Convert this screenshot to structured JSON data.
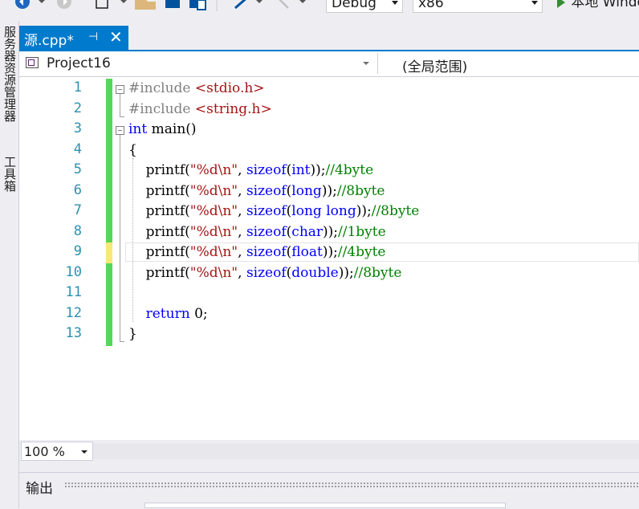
{
  "toolbar": {
    "config": "Debug",
    "platform": "x86",
    "run_label": "本地 Windows 调试器"
  },
  "side_tabs": [
    "服务器资源管理器",
    "工具箱"
  ],
  "tab": {
    "label": "源.cpp*",
    "pin": "⊣",
    "close": "✕"
  },
  "navbar": {
    "project": "Project16",
    "scope": "(全局范围)"
  },
  "editor": {
    "lines": [
      {
        "n": "1",
        "tokens": [
          {
            "t": "#include ",
            "c": "pp"
          },
          {
            "t": "<stdio.h>",
            "c": "inc"
          }
        ]
      },
      {
        "n": "2",
        "tokens": [
          {
            "t": "#include ",
            "c": "pp"
          },
          {
            "t": "<string.h>",
            "c": "inc"
          }
        ]
      },
      {
        "n": "3",
        "tokens": [
          {
            "t": "int",
            "c": "kw"
          },
          {
            "t": " main()",
            "c": ""
          }
        ]
      },
      {
        "n": "4",
        "tokens": [
          {
            "t": "{",
            "c": ""
          }
        ]
      },
      {
        "n": "5",
        "tokens": [
          {
            "t": "    printf(",
            "c": ""
          },
          {
            "t": "\"%d\\n\"",
            "c": "str"
          },
          {
            "t": ", ",
            "c": ""
          },
          {
            "t": "sizeof",
            "c": "kw"
          },
          {
            "t": "(",
            "c": ""
          },
          {
            "t": "int",
            "c": "kw"
          },
          {
            "t": "));",
            "c": ""
          },
          {
            "t": "//4byte",
            "c": "cm"
          }
        ]
      },
      {
        "n": "6",
        "tokens": [
          {
            "t": "    printf(",
            "c": ""
          },
          {
            "t": "\"%d\\n\"",
            "c": "str"
          },
          {
            "t": ", ",
            "c": ""
          },
          {
            "t": "sizeof",
            "c": "kw"
          },
          {
            "t": "(",
            "c": ""
          },
          {
            "t": "long",
            "c": "kw"
          },
          {
            "t": "));",
            "c": ""
          },
          {
            "t": "//8byte",
            "c": "cm"
          }
        ]
      },
      {
        "n": "7",
        "tokens": [
          {
            "t": "    printf(",
            "c": ""
          },
          {
            "t": "\"%d\\n\"",
            "c": "str"
          },
          {
            "t": ", ",
            "c": ""
          },
          {
            "t": "sizeof",
            "c": "kw"
          },
          {
            "t": "(",
            "c": ""
          },
          {
            "t": "long long",
            "c": "kw"
          },
          {
            "t": "));",
            "c": ""
          },
          {
            "t": "//8byte",
            "c": "cm"
          }
        ]
      },
      {
        "n": "8",
        "tokens": [
          {
            "t": "    printf(",
            "c": ""
          },
          {
            "t": "\"%d\\n\"",
            "c": "str"
          },
          {
            "t": ", ",
            "c": ""
          },
          {
            "t": "sizeof",
            "c": "kw"
          },
          {
            "t": "(",
            "c": ""
          },
          {
            "t": "char",
            "c": "kw"
          },
          {
            "t": "));",
            "c": ""
          },
          {
            "t": "//1byte",
            "c": "cm"
          }
        ]
      },
      {
        "n": "9",
        "tokens": [
          {
            "t": "    printf(",
            "c": ""
          },
          {
            "t": "\"%d\\n\"",
            "c": "str"
          },
          {
            "t": ", ",
            "c": ""
          },
          {
            "t": "sizeof",
            "c": "kw"
          },
          {
            "t": "(",
            "c": ""
          },
          {
            "t": "float",
            "c": "kw"
          },
          {
            "t": "));",
            "c": ""
          },
          {
            "t": "//4byte",
            "c": "cm"
          }
        ]
      },
      {
        "n": "10",
        "tokens": [
          {
            "t": "    printf(",
            "c": ""
          },
          {
            "t": "\"%d\\n\"",
            "c": "str"
          },
          {
            "t": ", ",
            "c": ""
          },
          {
            "t": "sizeof",
            "c": "kw"
          },
          {
            "t": "(",
            "c": ""
          },
          {
            "t": "double",
            "c": "kw"
          },
          {
            "t": "));",
            "c": ""
          },
          {
            "t": "//8byte",
            "c": "cm"
          }
        ]
      },
      {
        "n": "11",
        "tokens": []
      },
      {
        "n": "12",
        "tokens": [
          {
            "t": "    ",
            "c": ""
          },
          {
            "t": "return",
            "c": "kw"
          },
          {
            "t": " 0;",
            "c": ""
          }
        ]
      },
      {
        "n": "13",
        "tokens": [
          {
            "t": "}",
            "c": ""
          }
        ]
      }
    ],
    "changed_saved_color": "#57d657",
    "changed_unsaved_color": "#f7e87a"
  },
  "zoom": {
    "value": "100 %"
  },
  "output": {
    "title": "输出"
  }
}
